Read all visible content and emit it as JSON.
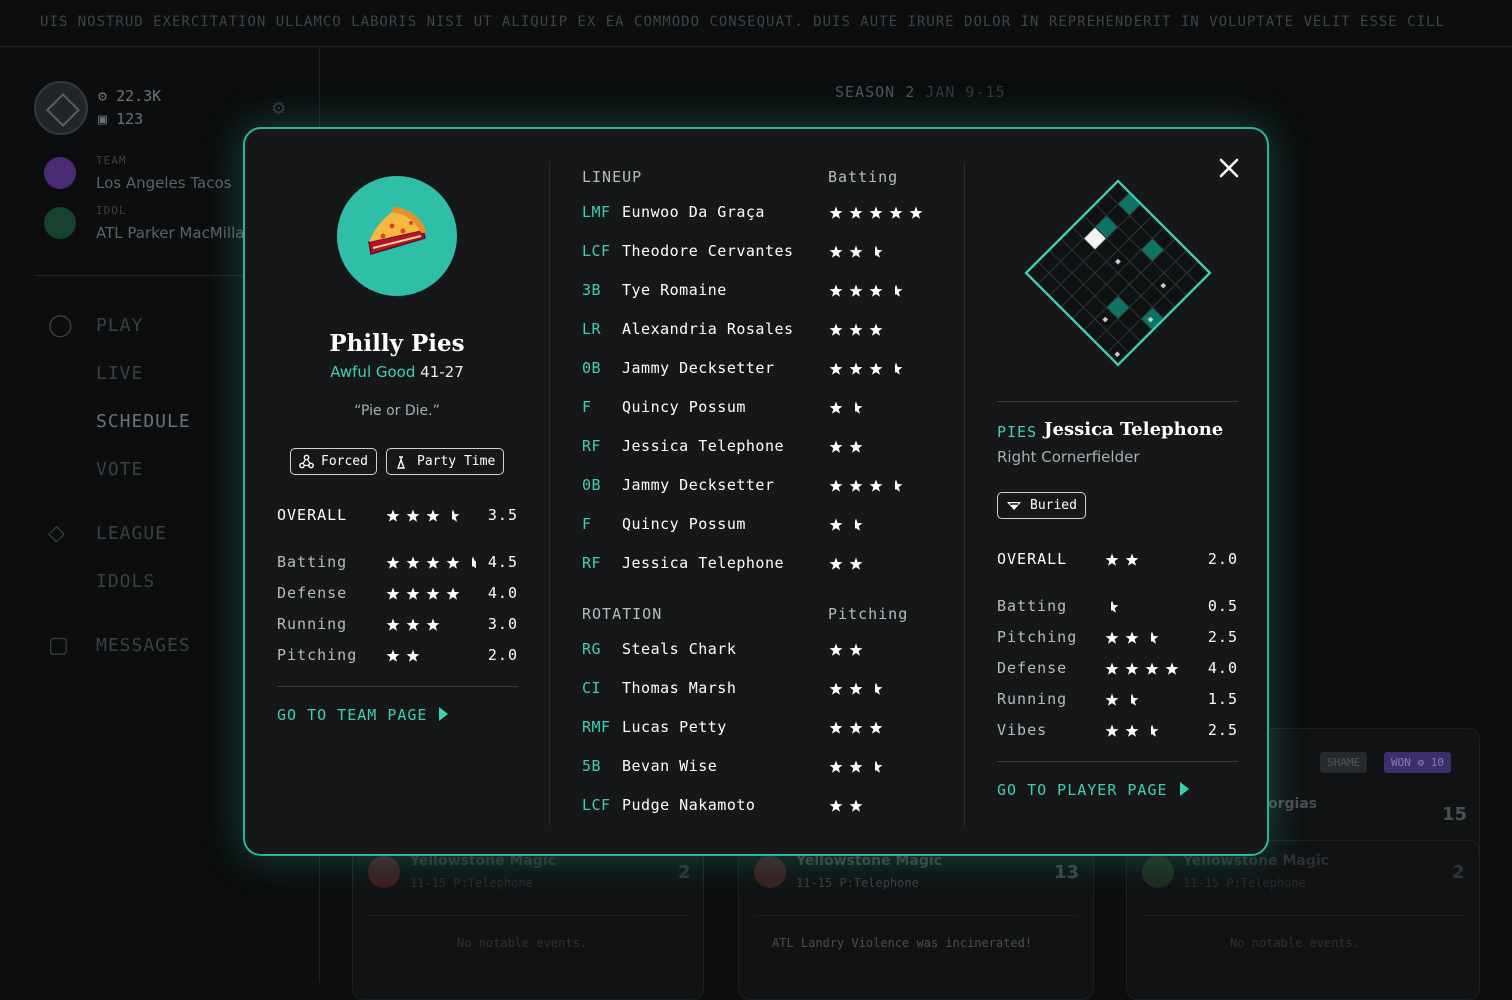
{
  "ticker": {
    "text": "UIS NOSTRUD EXERCITATION ULLAMCO LABORIS NISI UT ALIQUIP EX EA COMMODO CONSEQUAT. DUIS AUTE IRURE DOLOR IN REPREHENDERIT IN VOLUPTATE VELIT ESSE CILL"
  },
  "sidebar": {
    "coins": "22.3K",
    "votes": "123",
    "team_label": "TEAM",
    "team_value": "Los Angeles Tacos",
    "idol_label": "IDOL",
    "idol_value": "ATL Parker MacMillan",
    "nav": {
      "play": "PLAY",
      "live": "LIVE",
      "schedule": "SCHEDULE",
      "vote": "VOTE",
      "league": "LEAGUE",
      "idols": "IDOLS",
      "messages": "MESSAGES"
    }
  },
  "season": {
    "label": "SEASON 2",
    "dates": "JAN 9-15"
  },
  "background_cards": {
    "shame": "SHAME",
    "won": "WON",
    "won_amount": "10",
    "partial_team": "orgias",
    "partial_score": "15",
    "cards": [
      {
        "team": "Yellowstone Magic",
        "sub": "11-15  P:Telephone",
        "score": "2",
        "note": "No notable events."
      },
      {
        "team": "Yellowstone Magic",
        "sub": "11-15  P:Telephone",
        "score": "13",
        "note": "ATL Landry Violence was incinerated!"
      },
      {
        "team": "Yellowstone Magic",
        "sub": "11-15  P:Telephone",
        "score": "2",
        "note": "No notable events."
      }
    ]
  },
  "team": {
    "name": "Philly Pies",
    "record_label": "Awful Good",
    "record": "41-27",
    "slogan": "“Pie or Die.”",
    "modifiers": [
      "Forced",
      "Party Time"
    ],
    "overall_label": "OVERALL",
    "overall": 3.5,
    "overall_text": "3.5",
    "stats": [
      {
        "label": "Batting",
        "value": 4.5,
        "text": "4.5"
      },
      {
        "label": "Defense",
        "value": 4.0,
        "text": "4.0"
      },
      {
        "label": "Running",
        "value": 3.0,
        "text": "3.0"
      },
      {
        "label": "Pitching",
        "value": 2.0,
        "text": "2.0"
      }
    ],
    "goto": "GO TO TEAM PAGE"
  },
  "lineup": {
    "header": "LINEUP",
    "header_stat": "Batting",
    "players": [
      {
        "pos": "LMF",
        "name": "Eunwoo Da Graça",
        "stars": 5.0
      },
      {
        "pos": "LCF",
        "name": "Theodore Cervantes",
        "stars": 2.5
      },
      {
        "pos": "3B",
        "name": "Tye Romaine",
        "stars": 3.5
      },
      {
        "pos": "LR",
        "name": "Alexandria Rosales",
        "stars": 3.0
      },
      {
        "pos": "0B",
        "name": "Jammy Decksetter",
        "stars": 3.5
      },
      {
        "pos": "F",
        "name": "Quincy Possum",
        "stars": 1.5
      },
      {
        "pos": "RF",
        "name": "Jessica Telephone",
        "stars": 2.0
      },
      {
        "pos": "0B",
        "name": "Jammy Decksetter",
        "stars": 3.5
      },
      {
        "pos": "F",
        "name": "Quincy Possum",
        "stars": 1.5
      },
      {
        "pos": "RF",
        "name": "Jessica Telephone",
        "stars": 2.0
      }
    ]
  },
  "rotation": {
    "header": "ROTATION",
    "header_stat": "Pitching",
    "players": [
      {
        "pos": "RG",
        "name": "Steals Chark",
        "stars": 2.0
      },
      {
        "pos": "CI",
        "name": "Thomas Marsh",
        "stars": 2.5
      },
      {
        "pos": "RMF",
        "name": "Lucas Petty",
        "stars": 3.0
      },
      {
        "pos": "5B",
        "name": "Bevan Wise",
        "stars": 2.5
      },
      {
        "pos": "LCF",
        "name": "Pudge Nakamoto",
        "stars": 2.0
      }
    ]
  },
  "player": {
    "team_abbr": "PIES",
    "name": "Jessica Telephone",
    "position": "Right Cornerfielder",
    "modifier": "Buried",
    "overall_label": "OVERALL",
    "overall": 2.0,
    "overall_text": "2.0",
    "stats": [
      {
        "label": "Batting",
        "value": 0.5,
        "text": "0.5"
      },
      {
        "label": "Pitching",
        "value": 2.5,
        "text": "2.5"
      },
      {
        "label": "Defense",
        "value": 4.0,
        "text": "4.0"
      },
      {
        "label": "Running",
        "value": 1.5,
        "text": "1.5"
      },
      {
        "label": "Vibes",
        "value": 2.5,
        "text": "2.5"
      }
    ],
    "goto": "GO TO PLAYER PAGE"
  },
  "colors": {
    "accent": "#3ed0b5",
    "modal_border": "#2cb39b",
    "logo_bg": "#2fbfa8",
    "grid_fill": "#0e7468"
  }
}
